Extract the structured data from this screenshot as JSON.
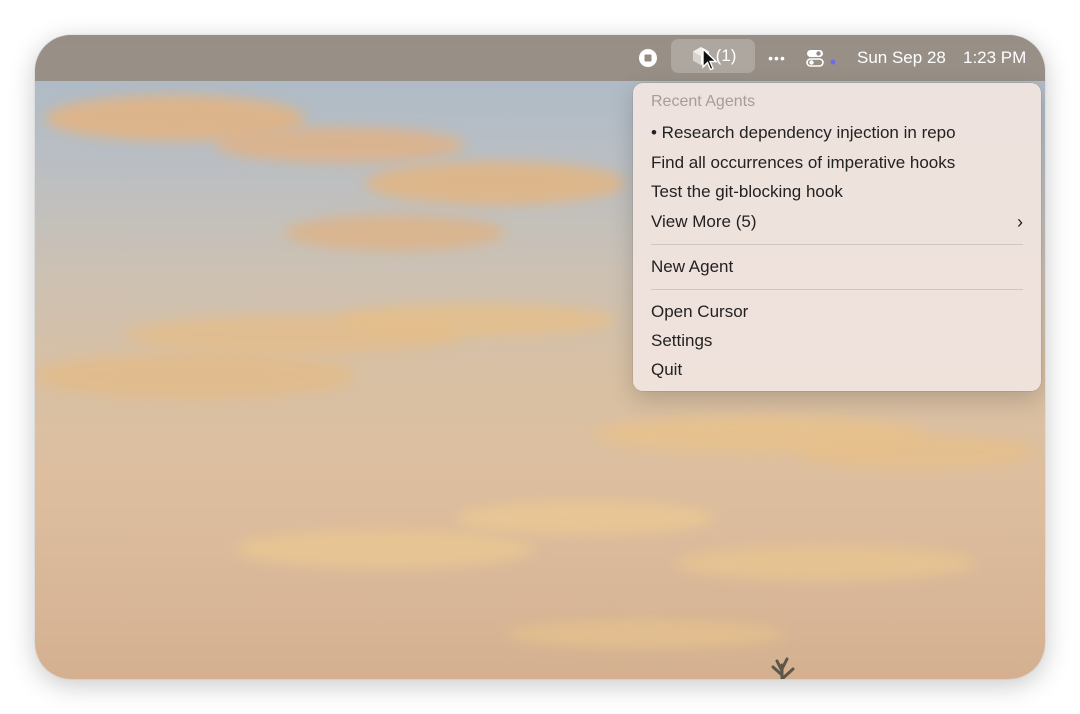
{
  "menubar": {
    "agent_count": "(1)",
    "dots": "•••",
    "date": "Sun Sep 28",
    "time": "1:23 PM",
    "icons": [
      "stop-icon",
      "cursor-cube-icon",
      "more-dots-icon",
      "control-center-icon"
    ],
    "accent": "#6a6cf0"
  },
  "dropdown": {
    "header": "Recent Agents",
    "recent": [
      "• Research dependency injection in repo",
      "Find all occurrences of imperative hooks",
      "Test the git-blocking hook"
    ],
    "view_more": "View More (5)",
    "chevron": "›",
    "new_agent": "New Agent",
    "open_cursor": "Open Cursor",
    "settings": "Settings",
    "quit": "Quit"
  }
}
